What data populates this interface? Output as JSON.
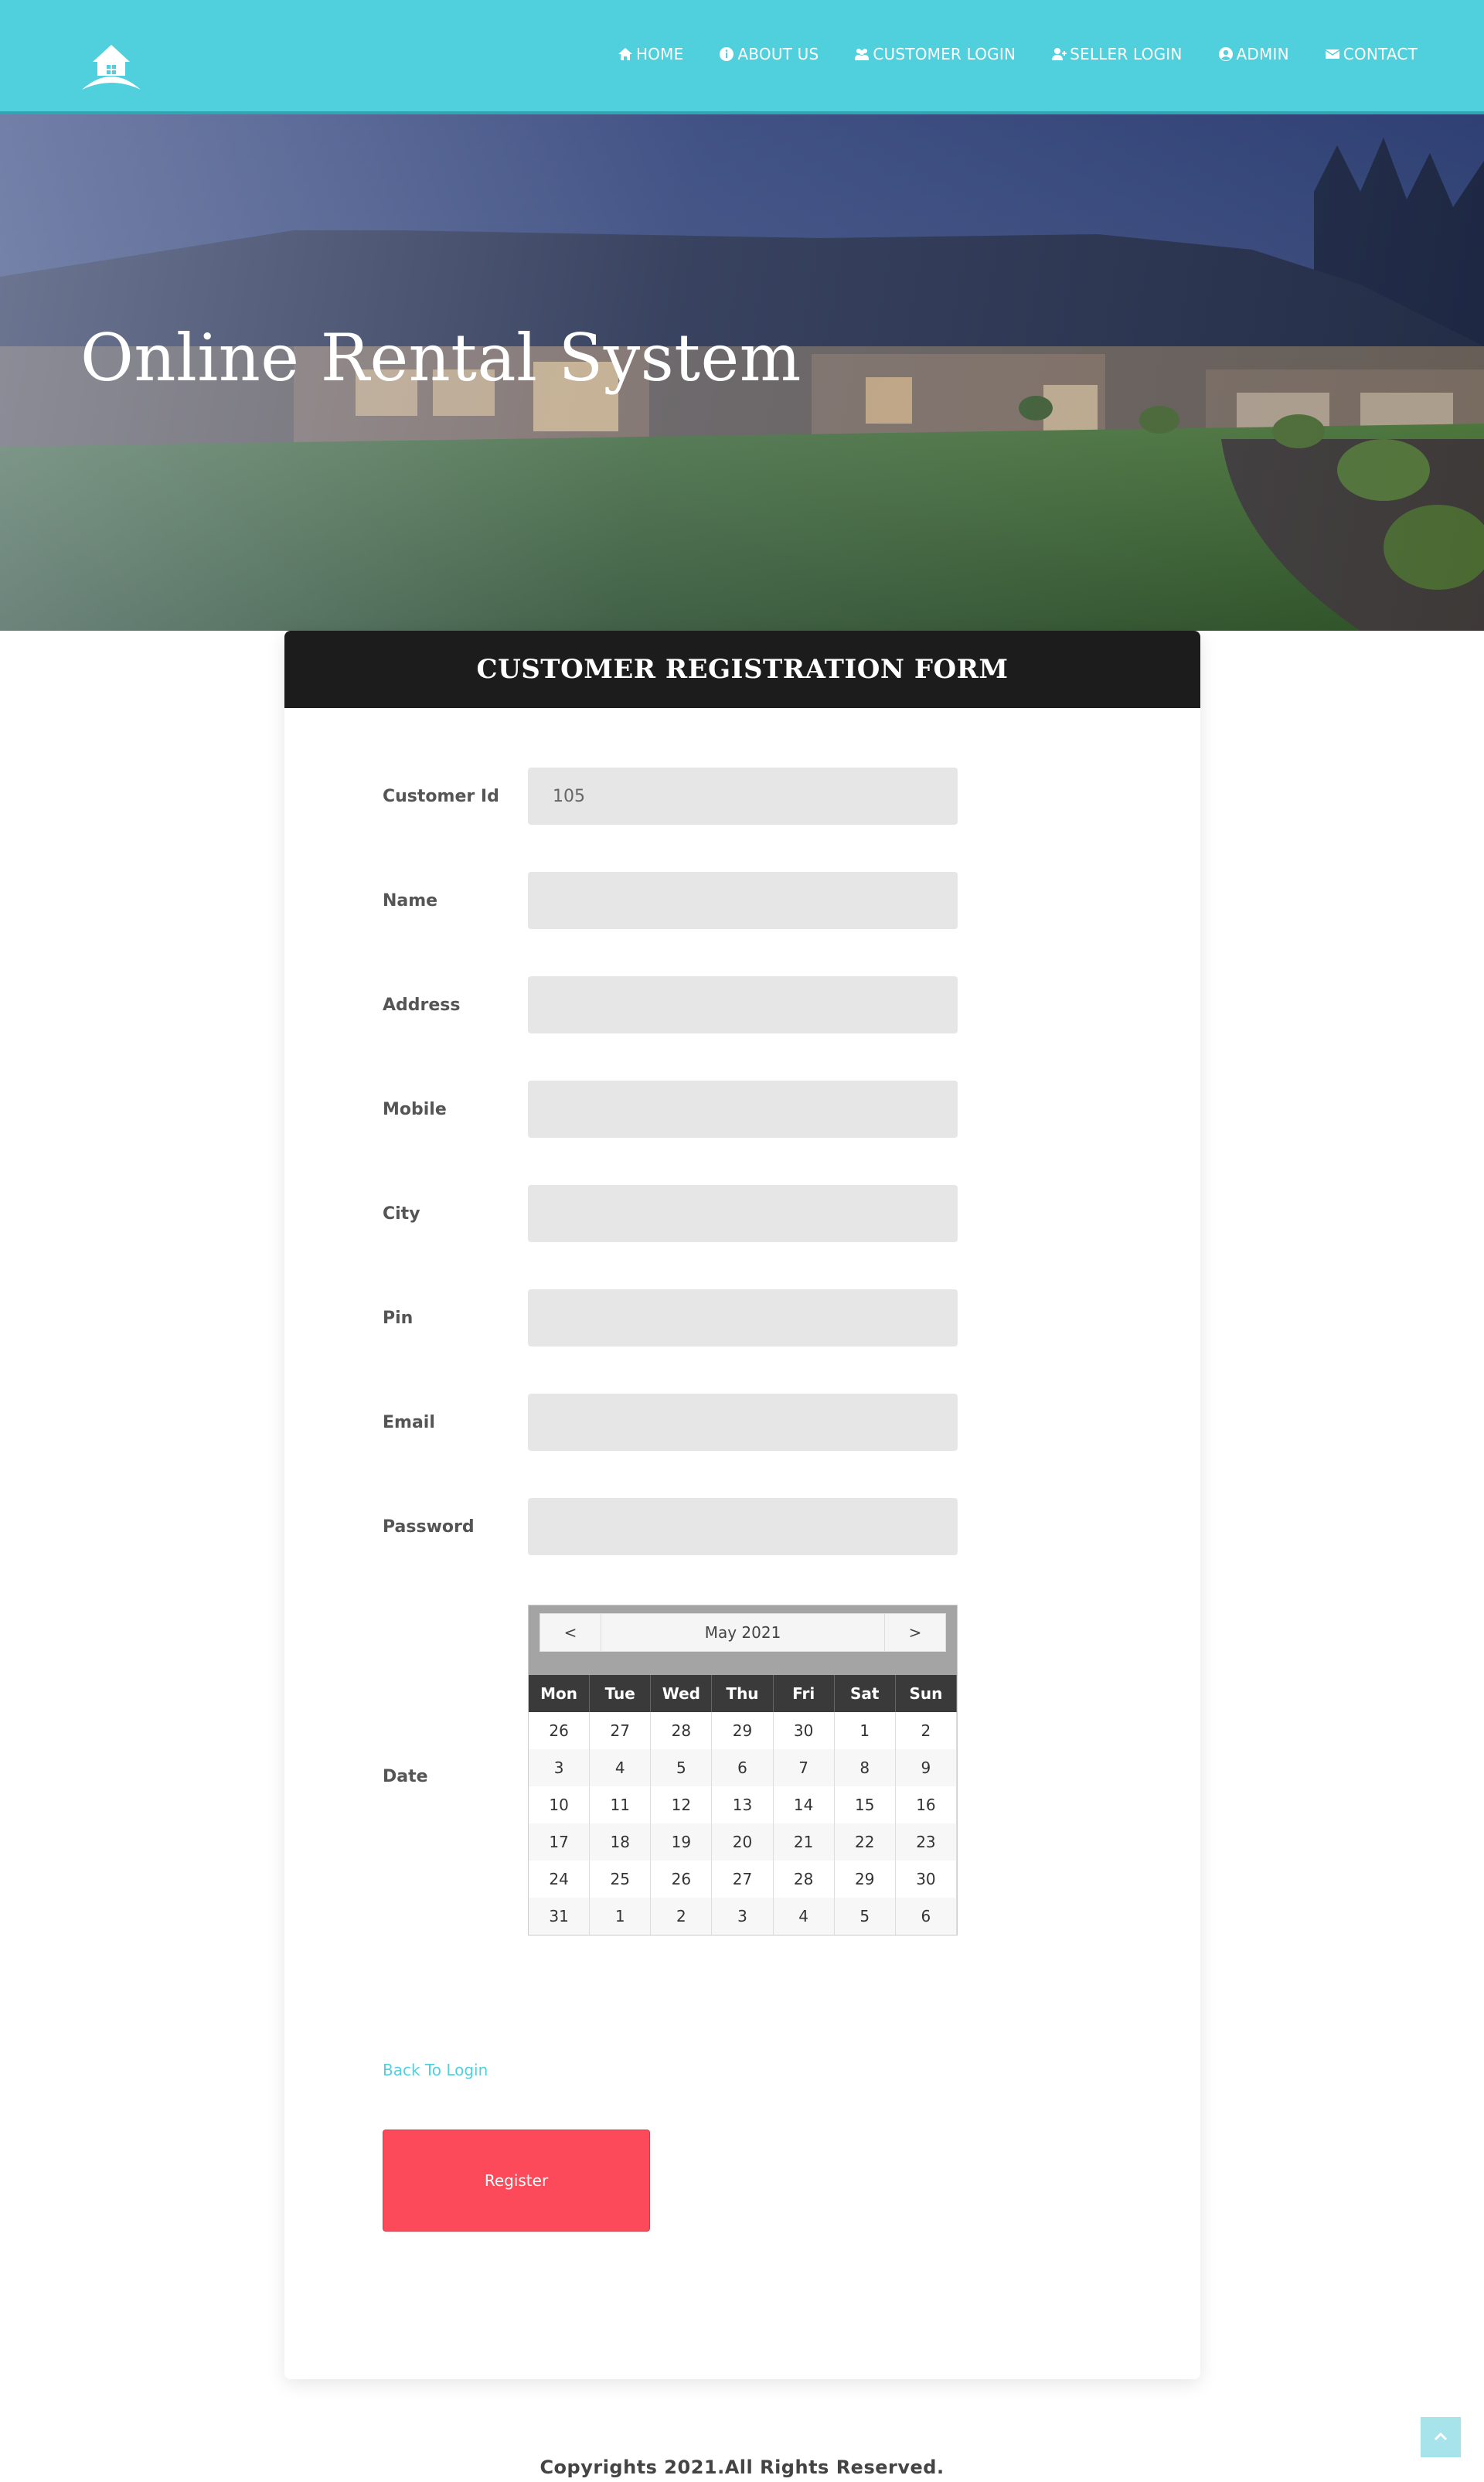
{
  "nav": {
    "items": [
      {
        "label": "HOME",
        "icon": "home-icon"
      },
      {
        "label": "ABOUT US",
        "icon": "info-icon"
      },
      {
        "label": "CUSTOMER LOGIN",
        "icon": "users-icon"
      },
      {
        "label": "SELLER LOGIN",
        "icon": "user-plus-icon"
      },
      {
        "label": "ADMIN",
        "icon": "user-circle-icon"
      },
      {
        "label": "CONTACT",
        "icon": "envelope-icon"
      }
    ]
  },
  "hero": {
    "title": "Online Rental System"
  },
  "form": {
    "title": "CUSTOMER REGISTRATION FORM",
    "fields": [
      {
        "label": "Customer Id",
        "value": "105"
      },
      {
        "label": "Name",
        "value": ""
      },
      {
        "label": "Address",
        "value": ""
      },
      {
        "label": "Mobile",
        "value": ""
      },
      {
        "label": "City",
        "value": ""
      },
      {
        "label": "Pin",
        "value": ""
      },
      {
        "label": "Email",
        "value": ""
      },
      {
        "label": "Password",
        "value": ""
      }
    ],
    "date_label": "Date",
    "calendar": {
      "prev": "<",
      "next": ">",
      "month_title": "May 2021",
      "weekdays": [
        "Mon",
        "Tue",
        "Wed",
        "Thu",
        "Fri",
        "Sat",
        "Sun"
      ],
      "weeks": [
        [
          "26",
          "27",
          "28",
          "29",
          "30",
          "1",
          "2"
        ],
        [
          "3",
          "4",
          "5",
          "6",
          "7",
          "8",
          "9"
        ],
        [
          "10",
          "11",
          "12",
          "13",
          "14",
          "15",
          "16"
        ],
        [
          "17",
          "18",
          "19",
          "20",
          "21",
          "22",
          "23"
        ],
        [
          "24",
          "25",
          "26",
          "27",
          "28",
          "29",
          "30"
        ],
        [
          "31",
          "1",
          "2",
          "3",
          "4",
          "5",
          "6"
        ]
      ]
    },
    "back_link": "Back To Login",
    "submit": "Register"
  },
  "footer": {
    "copyright": "Copyrights 2021.All Rights Reserved."
  },
  "colors": {
    "navbar": "#50d0dd",
    "accent": "#fc4a5a",
    "header": "#1c1c1c"
  }
}
